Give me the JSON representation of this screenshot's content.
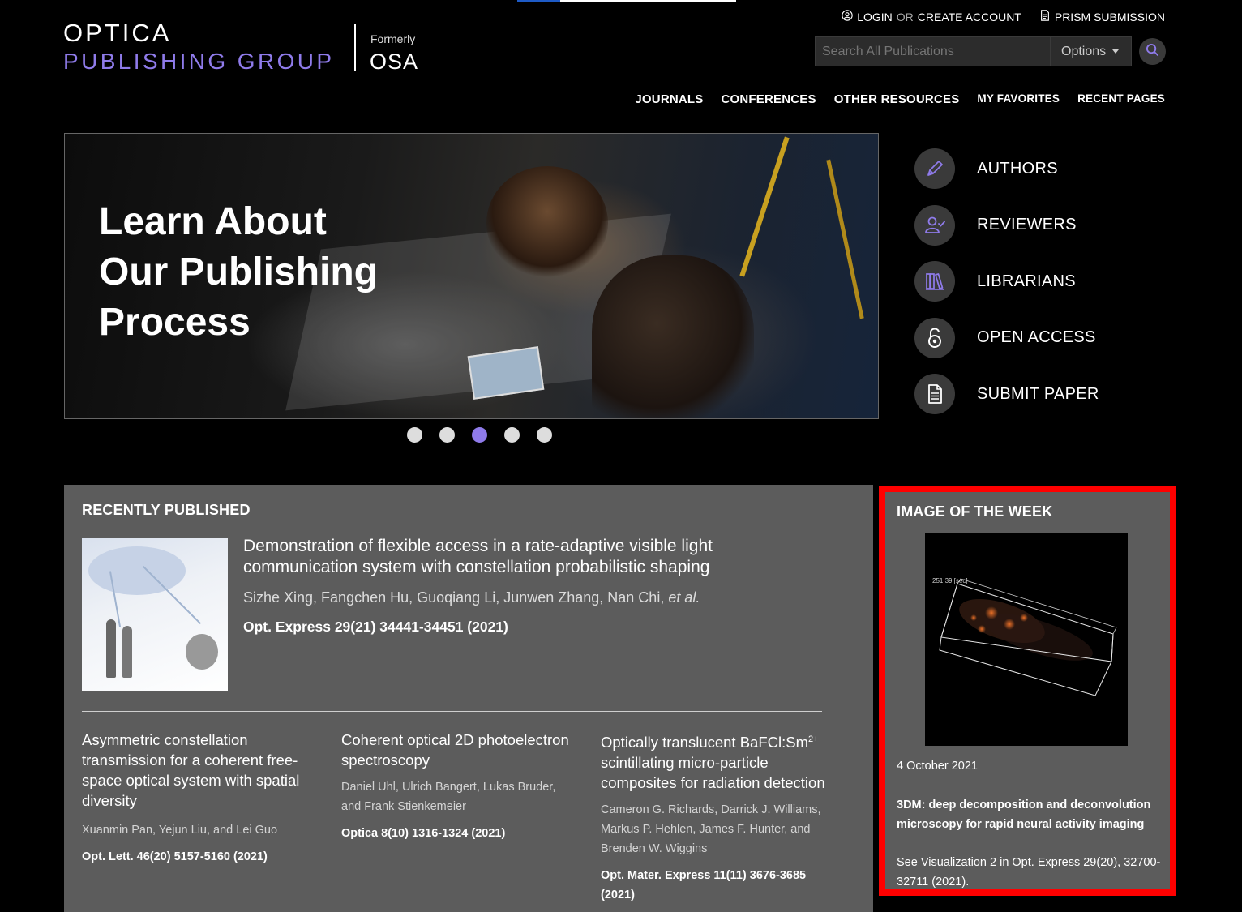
{
  "colors": {
    "accent": "#8f7bea",
    "highlight_border": "#ff0000",
    "panel_bg": "#5c5c5c"
  },
  "logo": {
    "main": "OPTICA",
    "sub": "PUBLISHING GROUP",
    "formerly": "Formerly",
    "osa": "OSA"
  },
  "account": {
    "login": "LOGIN",
    "or": "OR",
    "create": "CREATE ACCOUNT",
    "prism": "PRISM SUBMISSION"
  },
  "search": {
    "placeholder": "Search All Publications",
    "options_label": "Options"
  },
  "nav": [
    "JOURNALS",
    "CONFERENCES",
    "OTHER RESOURCES",
    "MY FAVORITES",
    "RECENT PAGES"
  ],
  "hero": {
    "title_line1": "Learn About",
    "title_line2": "Our Publishing",
    "title_line3": "Process",
    "active_slide": 3,
    "slide_count": 5
  },
  "side_links": [
    {
      "label": "AUTHORS",
      "icon": "pen-icon"
    },
    {
      "label": "REVIEWERS",
      "icon": "user-check-icon"
    },
    {
      "label": "LIBRARIANS",
      "icon": "books-icon"
    },
    {
      "label": "OPEN ACCESS",
      "icon": "open-lock-icon"
    },
    {
      "label": "SUBMIT PAPER",
      "icon": "document-icon"
    }
  ],
  "recent": {
    "heading": "RECENTLY PUBLISHED",
    "featured": {
      "title": "Demonstration of flexible access in a rate-adaptive visible light communication system with constellation probabilistic shaping",
      "authors": "Sizhe Xing, Fangchen Hu, Guoqiang Li, Junwen Zhang, Nan Chi,",
      "authors_etal": "et al.",
      "citation": "Opt. Express 29(21) 34441-34451 (2021)"
    },
    "articles": [
      {
        "title": "Asymmetric constellation transmission for a coherent free-space optical system with spatial diversity",
        "authors": "Xuanmin Pan, Yejun Liu, and Lei Guo",
        "citation": "Opt. Lett. 46(20) 5157-5160 (2021)"
      },
      {
        "title": "Coherent optical 2D photoelectron spectroscopy",
        "authors": "Daniel Uhl, Ulrich Bangert, Lukas Bruder, and Frank Stienkemeier",
        "citation": "Optica 8(10) 1316-1324 (2021)"
      },
      {
        "title_pre": "Optically translucent BaFCl:Sm",
        "title_sup": "2+",
        "title_post": " scintillating micro-particle composites for radiation detection",
        "authors": "Cameron G. Richards, Darrick J. Williams, Markus P. Hehlen, James F. Hunter, and Brenden W. Wiggins",
        "citation": "Opt. Mater. Express 11(11) 3676-3685 (2021)"
      }
    ]
  },
  "iotw": {
    "heading": "IMAGE OF THE WEEK",
    "image_label": "251.39 [sec]",
    "date": "4 October 2021",
    "title": "3DM: deep decomposition and deconvolution microscopy for rapid neural activity imaging",
    "see": "See Visualization 2 in Opt. Express 29(20), 32700-32711 (2021)."
  }
}
